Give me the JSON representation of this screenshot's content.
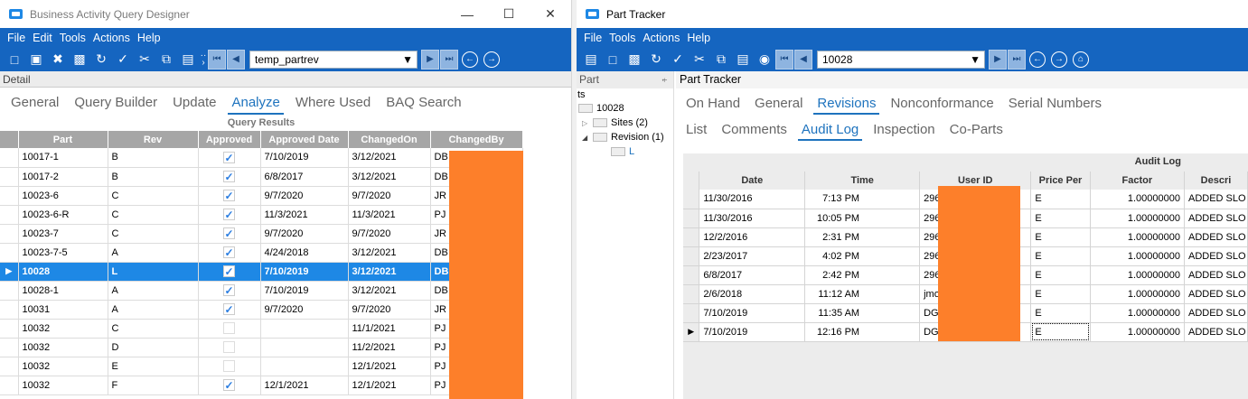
{
  "left": {
    "title": "Business Activity Query Designer",
    "menu": [
      "File",
      "Edit",
      "Tools",
      "Actions",
      "Help"
    ],
    "combo_value": "temp_partrev",
    "detail_label": "Detail",
    "tabs": [
      "General",
      "Query Builder",
      "Update",
      "Analyze",
      "Where Used",
      "BAQ Search"
    ],
    "active_tab": "Analyze",
    "grid_caption": "Query Results",
    "columns": [
      "Part",
      "Rev",
      "Approved",
      "Approved Date",
      "ChangedOn",
      "ChangedBy"
    ],
    "rows": [
      {
        "part": "10017-1",
        "rev": "B",
        "approved": true,
        "approved_date": "7/10/2019",
        "changed_on": "3/12/2021",
        "changed_by": "DB"
      },
      {
        "part": "10017-2",
        "rev": "B",
        "approved": true,
        "approved_date": "6/8/2017",
        "changed_on": "3/12/2021",
        "changed_by": "DB"
      },
      {
        "part": "10023-6",
        "rev": "C",
        "approved": true,
        "approved_date": "9/7/2020",
        "changed_on": "9/7/2020",
        "changed_by": "JR"
      },
      {
        "part": "10023-6-R",
        "rev": "C",
        "approved": true,
        "approved_date": "11/3/2021",
        "changed_on": "11/3/2021",
        "changed_by": "PJ"
      },
      {
        "part": "10023-7",
        "rev": "C",
        "approved": true,
        "approved_date": "9/7/2020",
        "changed_on": "9/7/2020",
        "changed_by": "JR"
      },
      {
        "part": "10023-7-5",
        "rev": "A",
        "approved": true,
        "approved_date": "4/24/2018",
        "changed_on": "3/12/2021",
        "changed_by": "DB"
      },
      {
        "part": "10028",
        "rev": "L",
        "approved": true,
        "approved_date": "7/10/2019",
        "changed_on": "3/12/2021",
        "changed_by": "DB",
        "selected": true
      },
      {
        "part": "10028-1",
        "rev": "A",
        "approved": true,
        "approved_date": "7/10/2019",
        "changed_on": "3/12/2021",
        "changed_by": "DB"
      },
      {
        "part": "10031",
        "rev": "A",
        "approved": true,
        "approved_date": "9/7/2020",
        "changed_on": "9/7/2020",
        "changed_by": "JR"
      },
      {
        "part": "10032",
        "rev": "C",
        "approved": false,
        "approved_date": "",
        "changed_on": "11/1/2021",
        "changed_by": "PJ"
      },
      {
        "part": "10032",
        "rev": "D",
        "approved": false,
        "approved_date": "",
        "changed_on": "11/2/2021",
        "changed_by": "PJ"
      },
      {
        "part": "10032",
        "rev": "E",
        "approved": false,
        "approved_date": "",
        "changed_on": "12/1/2021",
        "changed_by": "PJ"
      },
      {
        "part": "10032",
        "rev": "F",
        "approved": true,
        "approved_date": "12/1/2021",
        "changed_on": "12/1/2021",
        "changed_by": "PJ"
      }
    ]
  },
  "right": {
    "title": "Part Tracker",
    "menu": [
      "File",
      "Tools",
      "Actions",
      "Help"
    ],
    "combo_value": "10028",
    "left_pane_label": "Part",
    "pin_glyph": "⍅",
    "tree": {
      "root_frag": "ts",
      "part": "10028",
      "sites": "Sites (2)",
      "revision": "Revision (1)",
      "rev_item": "L"
    },
    "pane_title": "Part Tracker",
    "tabs_row1": [
      "On Hand",
      "General",
      "Revisions",
      "Nonconformance",
      "Serial Numbers"
    ],
    "tabs_row2": [
      "List",
      "Comments",
      "Audit Log",
      "Inspection",
      "Co-Parts"
    ],
    "active_tab1": "Revisions",
    "active_tab2": "Audit Log",
    "audit_caption": "Audit Log",
    "columns": [
      "Date",
      "Time",
      "User ID",
      "Price Per",
      "Factor",
      "Descri"
    ],
    "rows": [
      {
        "date": "11/30/2016",
        "time": "7:13 PM",
        "user": "296",
        "price_per": "E",
        "factor": "1.00000000",
        "desc": "ADDED SLO"
      },
      {
        "date": "11/30/2016",
        "time": "10:05 PM",
        "user": "296",
        "price_per": "E",
        "factor": "1.00000000",
        "desc": "ADDED SLO"
      },
      {
        "date": "12/2/2016",
        "time": "2:31 PM",
        "user": "296",
        "price_per": "E",
        "factor": "1.00000000",
        "desc": "ADDED SLO"
      },
      {
        "date": "2/23/2017",
        "time": "4:02 PM",
        "user": "296",
        "price_per": "E",
        "factor": "1.00000000",
        "desc": "ADDED SLO"
      },
      {
        "date": "6/8/2017",
        "time": "2:42 PM",
        "user": "296",
        "price_per": "E",
        "factor": "1.00000000",
        "desc": "ADDED SLO"
      },
      {
        "date": "2/6/2018",
        "time": "11:12 AM",
        "user": "jmo",
        "price_per": "E",
        "factor": "1.00000000",
        "desc": "ADDED SLO"
      },
      {
        "date": "7/10/2019",
        "time": "11:35 AM",
        "user": "DG",
        "price_per": "E",
        "factor": "1.00000000",
        "desc": "ADDED SLO"
      },
      {
        "date": "7/10/2019",
        "time": "12:16 PM",
        "user": "DG",
        "price_per": "E",
        "factor": "1.00000000",
        "desc": "ADDED SLO",
        "current": true
      }
    ]
  },
  "colors": {
    "accent": "#1565c0",
    "selection": "#1e88e5",
    "redaction": "#fd7f2a"
  }
}
